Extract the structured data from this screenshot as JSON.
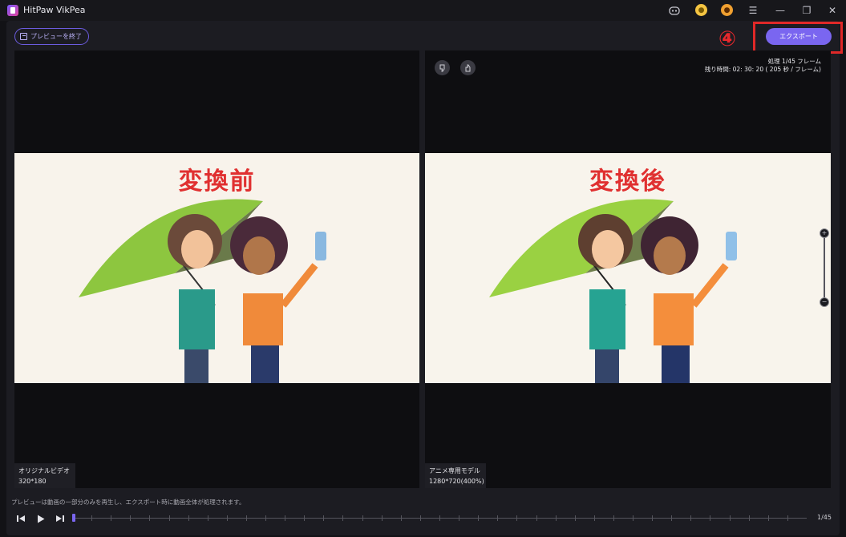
{
  "window": {
    "title": "HitPaw VikPea"
  },
  "toolbar": {
    "end_preview_label": "プレビューを終了",
    "export_label": "エクスポート",
    "callout_number": "④"
  },
  "panels": {
    "left": {
      "overlay_label": "変換前",
      "model_name": "オリジナルビデオ",
      "resolution": "320*180"
    },
    "right": {
      "overlay_label": "変換後",
      "model_name": "アニメ専用モデル",
      "resolution": "1280*720(400%)",
      "progress_text": "処理 1/45 フレーム",
      "remaining_text": "残り時間: 02: 30: 20 ( 205 秒 / フレーム)"
    }
  },
  "footer": {
    "hint": "プレビューは動画の一部分のみを再生し、エクスポート時に動画全体が処理されます。",
    "frame_count": "1/45",
    "playhead_fraction": 0.0
  },
  "icons": {
    "titlebar": [
      "discord-icon",
      "coin-icon",
      "user-icon",
      "menu-icon",
      "minimize-icon",
      "restore-icon",
      "close-icon"
    ],
    "controls": [
      "previous-frame-icon",
      "play-icon",
      "next-frame-icon"
    ],
    "rating": [
      "thumbs-down-icon",
      "thumbs-up-icon"
    ]
  },
  "colors": {
    "accent": "#7a66f0",
    "callout_red": "#e02828",
    "overlay_red": "#e03030"
  }
}
